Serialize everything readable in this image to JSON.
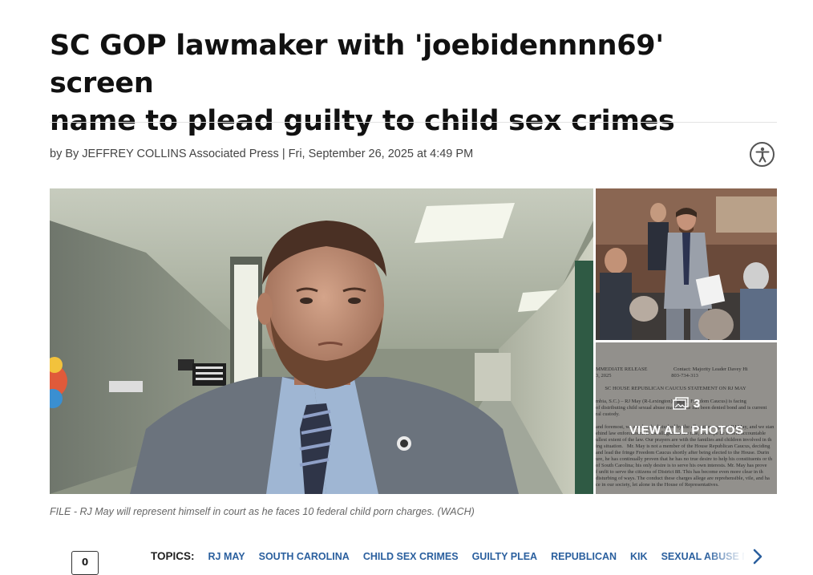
{
  "article": {
    "headline_line1": "SC GOP lawmaker with 'joebidennnn69' screen",
    "headline_line2": "name to plead guilty to child sex crimes",
    "byline": "by By JEFFREY COLLINS Associated Press | Fri, September 26, 2025 at 4:49 PM",
    "caption": "FILE - RJ May will represent himself in court as he faces 10 federal child porn charges. (WACH)"
  },
  "gallery": {
    "photo_count": "3",
    "view_all_label": "VIEW ALL PHOTOS",
    "doc_lines": [
      "MMEDIATE RELEASE                    Contact: Majority Leader Davey Hi",
      "3, 2025                                              803-734-313",
      "",
      "       SC HOUSE REPUBLICAN CAUCUS STATEMENT ON RJ MAY",
      "",
      "mbia, S.C.) – RJ May (R-Lexington), the SC Freedom Caucus) is facing",
      "of distributing child sexual abuse material, he has been denied bond and is current",
      "ral custody.",
      "",
      "and foremost, we are deeply disturbed by the allegations against RJ May, and we stan",
      "ehind law enforcement. If the allegations are true, we hope he is held accountable",
      "ullest extent of the law. Our prayers are with the families and children involved in th",
      "ing situation.   Mr. May is not a member of the House Republican Caucus, deciding",
      "and lead the fringe Freedom Caucus shortly after being elected to the House. Durin",
      "ure, he has continually proven that he has no true desire to help his constituents or th",
      "of South Carolina; his only desire is to serve his own interests. Mr. May has prove",
      "f unfit to serve the citizens of District 88. This has become even more clear in th",
      "disturbing of ways. The conduct these charges allege are reprehensible, vile, and ha",
      "ce in our society, let alone in the House of Representatives."
    ]
  },
  "footer": {
    "comment_count": "0",
    "topics_label": "TOPICS:",
    "topics": [
      "RJ MAY",
      "SOUTH CAROLINA",
      "CHILD SEX CRIMES",
      "GUILTY PLEA",
      "REPUBLICAN",
      "KIK",
      "SEXUAL ABUSE MA"
    ]
  },
  "colors": {
    "topic_link": "#2a5f9e",
    "headline": "#111111",
    "caption": "#666666"
  },
  "icons": {
    "accessibility": "accessibility-icon",
    "photos": "photo-stack-icon",
    "next": "chevron-right-icon"
  }
}
